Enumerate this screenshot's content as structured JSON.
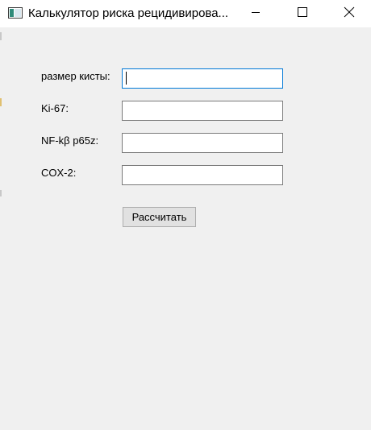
{
  "window": {
    "title": "Калькулятор риска рецидивирова...",
    "icon": "app-window-icon",
    "controls": {
      "minimize_icon": "minimize-icon",
      "maximize_icon": "maximize-icon",
      "close_icon": "close-icon"
    }
  },
  "form": {
    "fields": [
      {
        "label": "размер кисты:",
        "value": ""
      },
      {
        "label": "Ki-67:",
        "value": ""
      },
      {
        "label": "NF-kβ p65z:",
        "value": ""
      },
      {
        "label": "COX-2:",
        "value": ""
      }
    ],
    "submit_label": "Рассчитать"
  },
  "colors": {
    "window_background": "#f0f0f0",
    "titlebar_background": "#ffffff",
    "focus_border": "#0078d7",
    "input_border": "#7a7a7a",
    "button_background": "#e1e1e1"
  }
}
